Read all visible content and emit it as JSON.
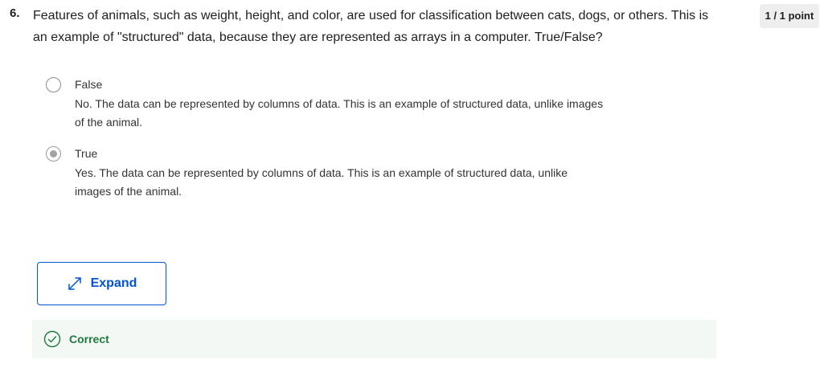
{
  "question": {
    "number": "6.",
    "text": "Features of animals, such as weight, height, and color, are used for classification between cats, dogs, or others. This is an example of \"structured\" data, because they are represented as arrays in a computer. True/False?",
    "points": "1 / 1 point"
  },
  "options": [
    {
      "label": "False",
      "feedback": "No. The data can be represented by columns of data. This is an example of structured data, unlike images of the animal.",
      "selected": false
    },
    {
      "label": "True",
      "feedback": "Yes. The data can be represented by columns of data. This is an example of structured data, unlike images of the animal.",
      "selected": true
    }
  ],
  "expand": {
    "label": "Expand",
    "icon": "expand-arrows-icon"
  },
  "result": {
    "label": "Correct",
    "icon": "check-circle-icon",
    "color": "#1e7a3e"
  },
  "colors": {
    "accent": "#0056d2",
    "success_bg": "#f4f8f4"
  }
}
